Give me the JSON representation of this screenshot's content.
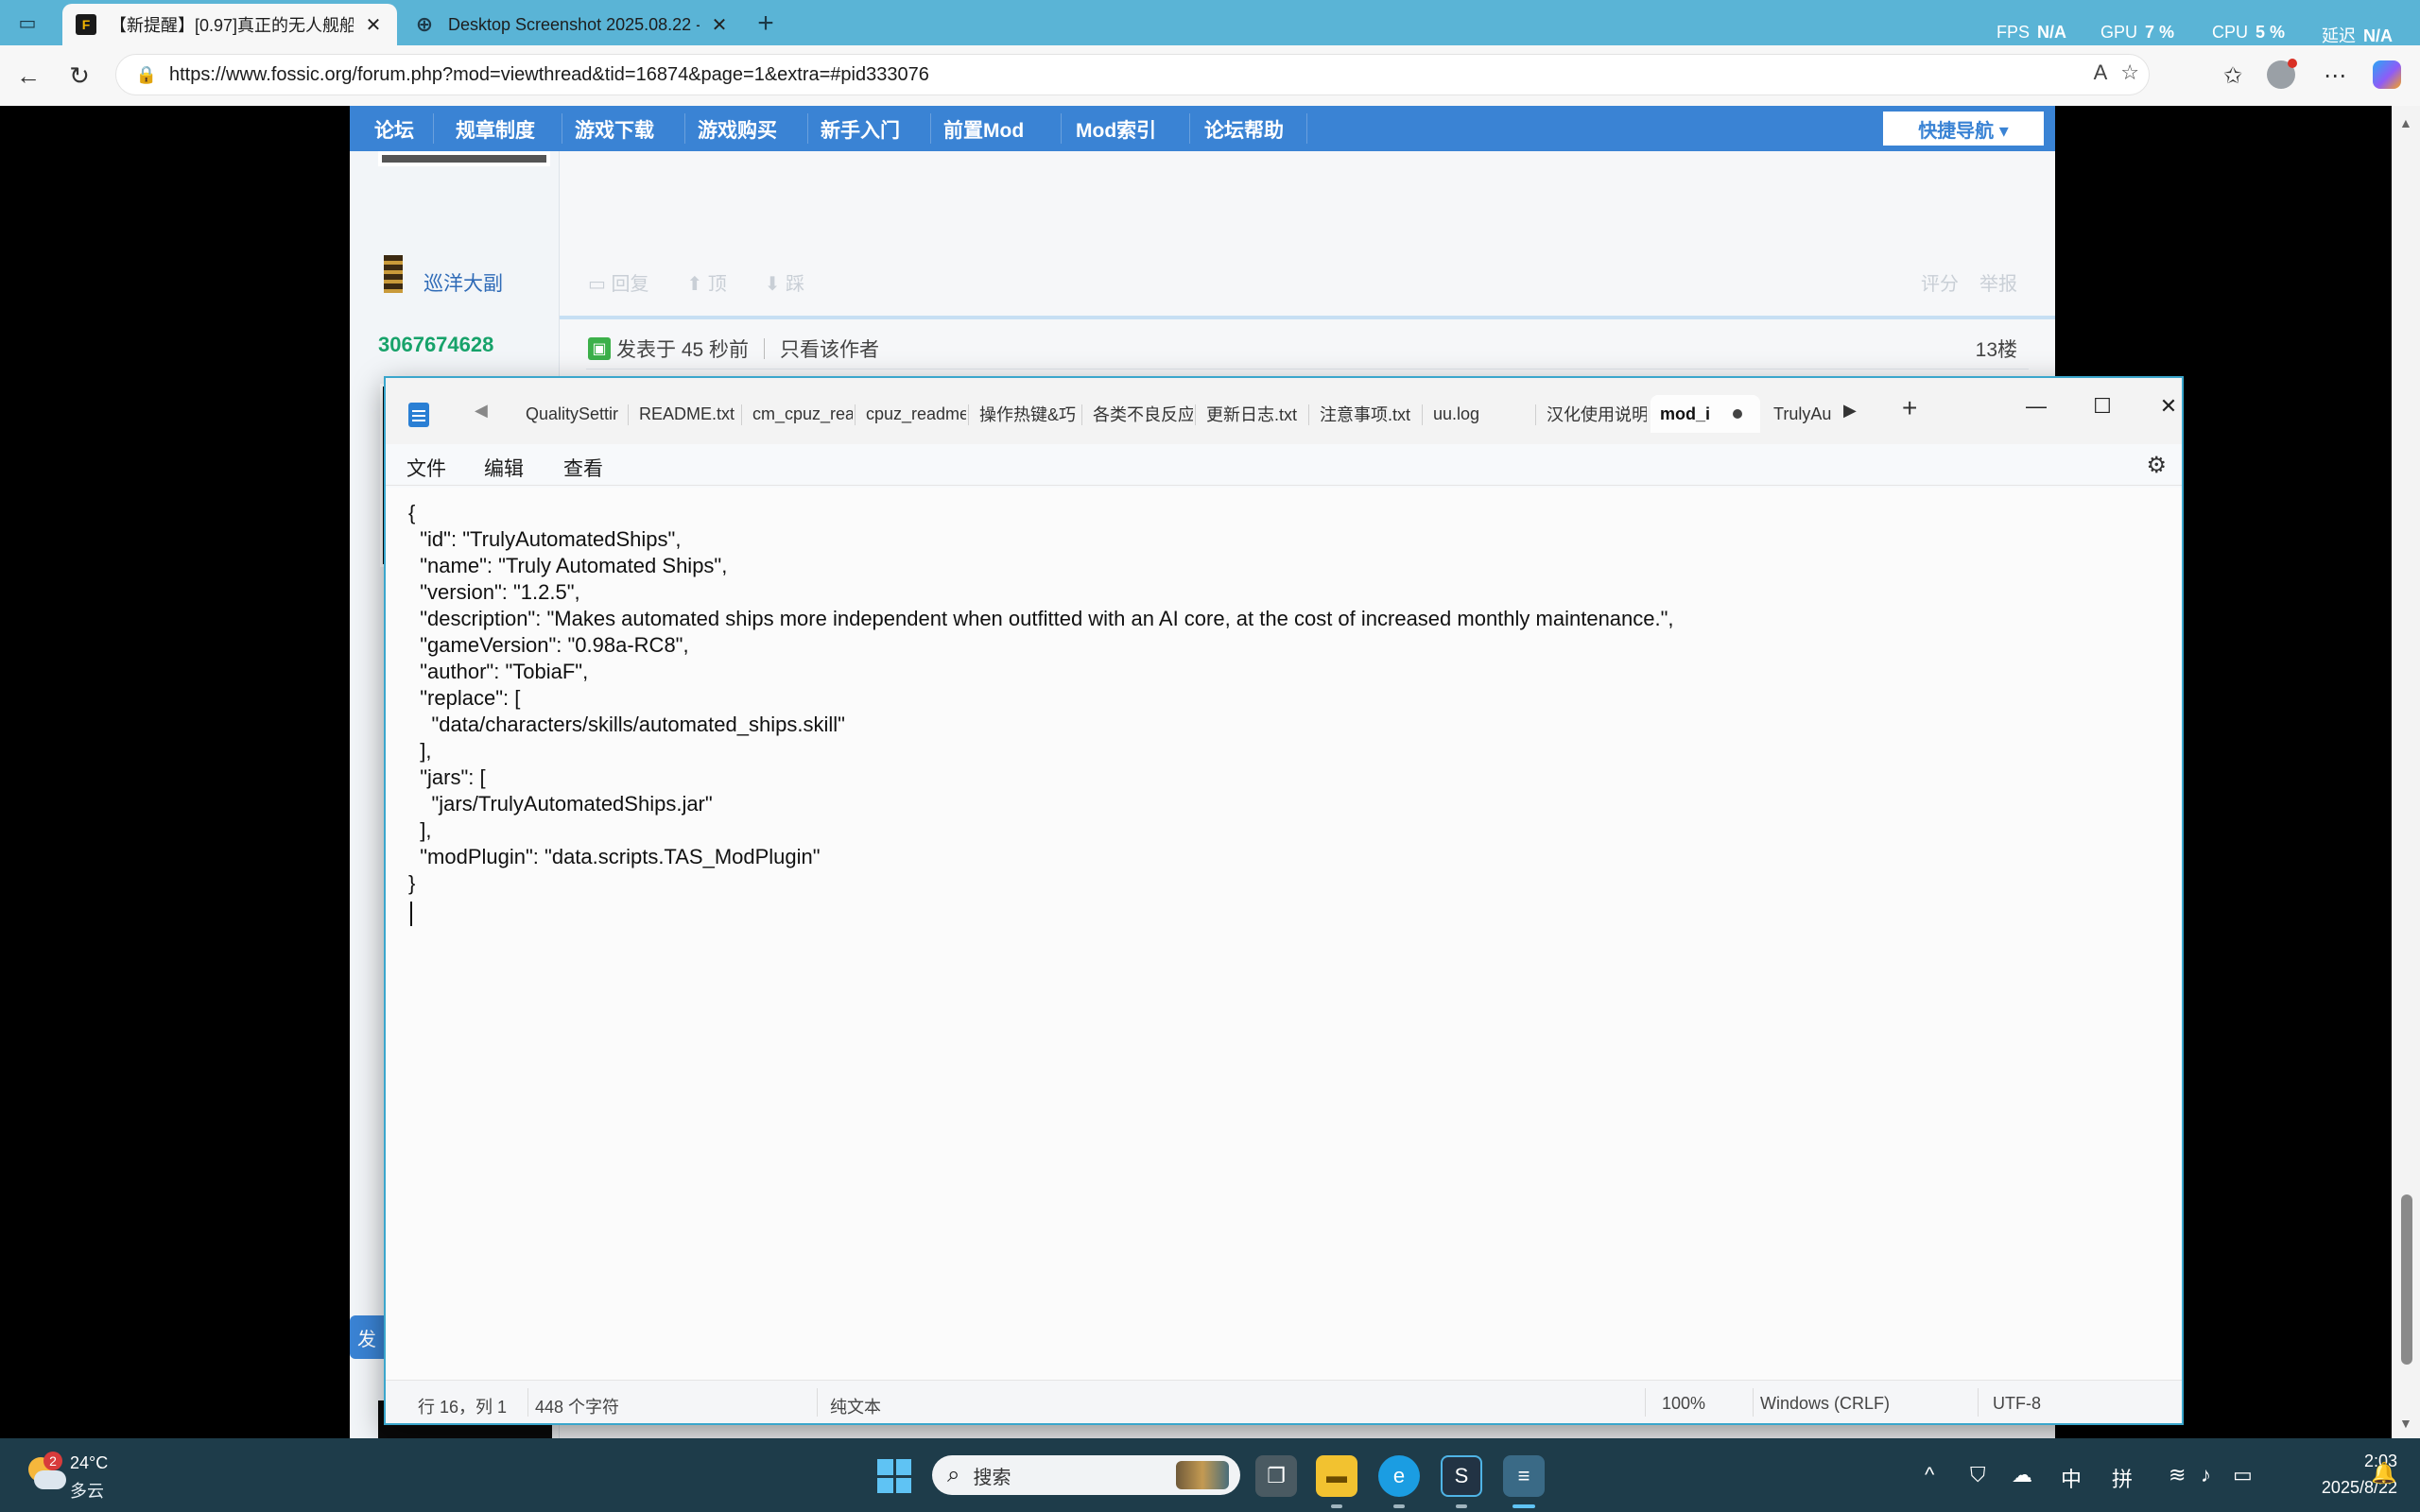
{
  "browser": {
    "tabs": [
      {
        "title": "【新提醒】[0.97]真正的无人舰船/",
        "favicon": "fossic-icon",
        "active": true
      },
      {
        "title": "Desktop Screenshot 2025.08.22 -",
        "favicon": "globe-icon",
        "active": false
      }
    ],
    "perf": {
      "fps_label": "FPS",
      "fps_value": "N/A",
      "gpu_label": "GPU",
      "gpu_value": "7 %",
      "cpu_label": "CPU",
      "cpu_value": "5 %",
      "delay_label": "延迟",
      "delay_value": "N/A"
    },
    "url": "https://www.fossic.org/forum.php?mod=viewthread&tid=16874&page=1&extra=#pid333076"
  },
  "forum": {
    "nav": [
      "论坛",
      "规章制度",
      "游戏下载",
      "游戏购买",
      "新手入门",
      "前置Mod",
      "Mod索引",
      "论坛帮助"
    ],
    "quick_nav": "快捷导航 ▾",
    "user": {
      "rank": "巡洋大副",
      "id": "3067674628"
    },
    "post_actions": [
      "回复",
      "顶",
      "踩"
    ],
    "post_actions_right": [
      "评分",
      "举报"
    ],
    "post_meta": {
      "posted": "发表于 45 秒前",
      "only_author": "只看该作者",
      "floor": "13楼"
    },
    "side_button": "发"
  },
  "notepad": {
    "tabs": [
      "QualitySettir",
      "README.txt",
      "cm_cpuz_rea",
      "cpuz_readme",
      "操作热键&巧",
      "各类不良反应",
      "更新日志.txt",
      "注意事项.txt",
      "uu.log",
      "汉化使用说明",
      "mod_i",
      "TrulyAu"
    ],
    "active_tab_index": 10,
    "menu": [
      "文件",
      "编辑",
      "查看"
    ],
    "content_lines": [
      "{",
      "  \"id\": \"TrulyAutomatedShips\",",
      "  \"name\": \"Truly Automated Ships\",",
      "  \"version\": \"1.2.5\",",
      "  \"description\": \"Makes automated ships more independent when outfitted with an AI core, at the cost of increased monthly maintenance.\",",
      "  \"gameVersion\": \"0.98a-RC8\",",
      "  \"author\": \"TobiaF\",",
      "  \"replace\": [",
      "    \"data/characters/skills/automated_ships.skill\"",
      "  ],",
      "  \"jars\": [",
      "    \"jars/TrulyAutomatedShips.jar\"",
      "  ],",
      "  \"modPlugin\": \"data.scripts.TAS_ModPlugin\"",
      "}"
    ],
    "status": {
      "position": "行 16，列 1",
      "chars": "448 个字符",
      "type": "纯文本",
      "zoom": "100%",
      "line_ending": "Windows (CRLF)",
      "encoding": "UTF-8"
    }
  },
  "taskbar": {
    "weather": {
      "badge": "2",
      "temp": "24°C",
      "desc": "多云"
    },
    "search_placeholder": "搜索",
    "tray": {
      "ime_lang": "中",
      "ime_mode": "拼"
    },
    "clock": {
      "time": "2:03",
      "date": "2025/8/22"
    }
  }
}
